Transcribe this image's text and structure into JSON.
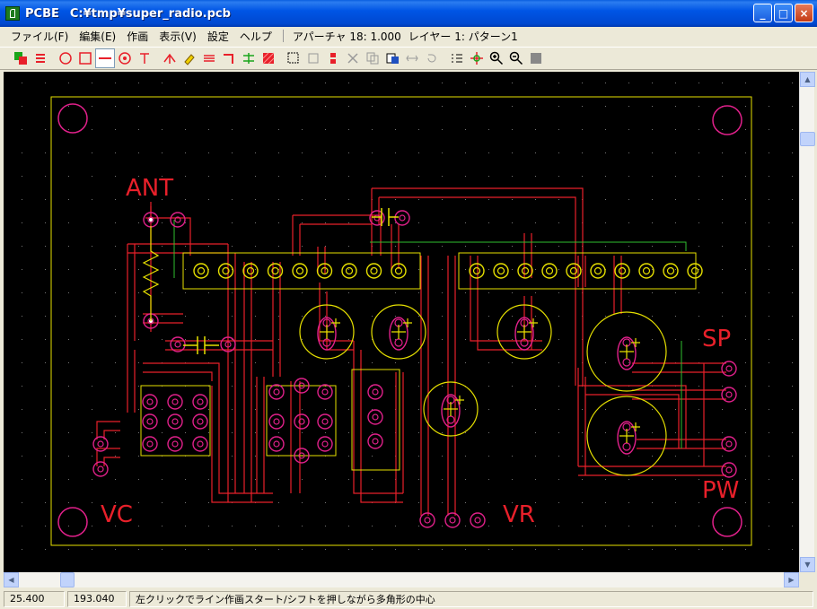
{
  "window": {
    "app_name": "PCBE",
    "file_path": "C:¥tmp¥super_radio.pcb"
  },
  "menu": {
    "items": [
      "ファイル(F)",
      "編集(E)",
      "作画",
      "表示(V)",
      "設定",
      "ヘルプ"
    ],
    "aperture": "アパーチャ 18: 1.000",
    "layer": "レイヤー 1: パターン1"
  },
  "toolbar": {
    "buttons": [
      "layers-icon",
      "layer-switch-icon",
      "circle-icon",
      "rectangle-icon",
      "line-icon",
      "pad-icon",
      "text-icon",
      "junction-icon",
      "eraser-icon",
      "bus-icon",
      "corner-icon",
      "split-icon",
      "fill-icon",
      "select-icon",
      "move-icon",
      "align-icon",
      "cut-icon",
      "copy-icon",
      "paste-icon",
      "stretch-icon",
      "undo-icon",
      "dots-icon",
      "crosshair-icon",
      "zoom-in-icon",
      "zoom-out-icon",
      "grid-icon"
    ]
  },
  "board": {
    "labels": {
      "ant": "ANT",
      "sp": "SP",
      "pw": "PW",
      "vc": "VC",
      "vr": "VR"
    },
    "colors": {
      "background": "#000000",
      "trace": "#e8202a",
      "outline": "#e6e000",
      "pad": "#e0208a",
      "silk": "#ffe600",
      "green": "#2fbf2f"
    }
  },
  "status": {
    "x": "25.400",
    "y": "193.040",
    "message": "左クリックでライン作画スタート/シフトを押しながら多角形の中心"
  }
}
